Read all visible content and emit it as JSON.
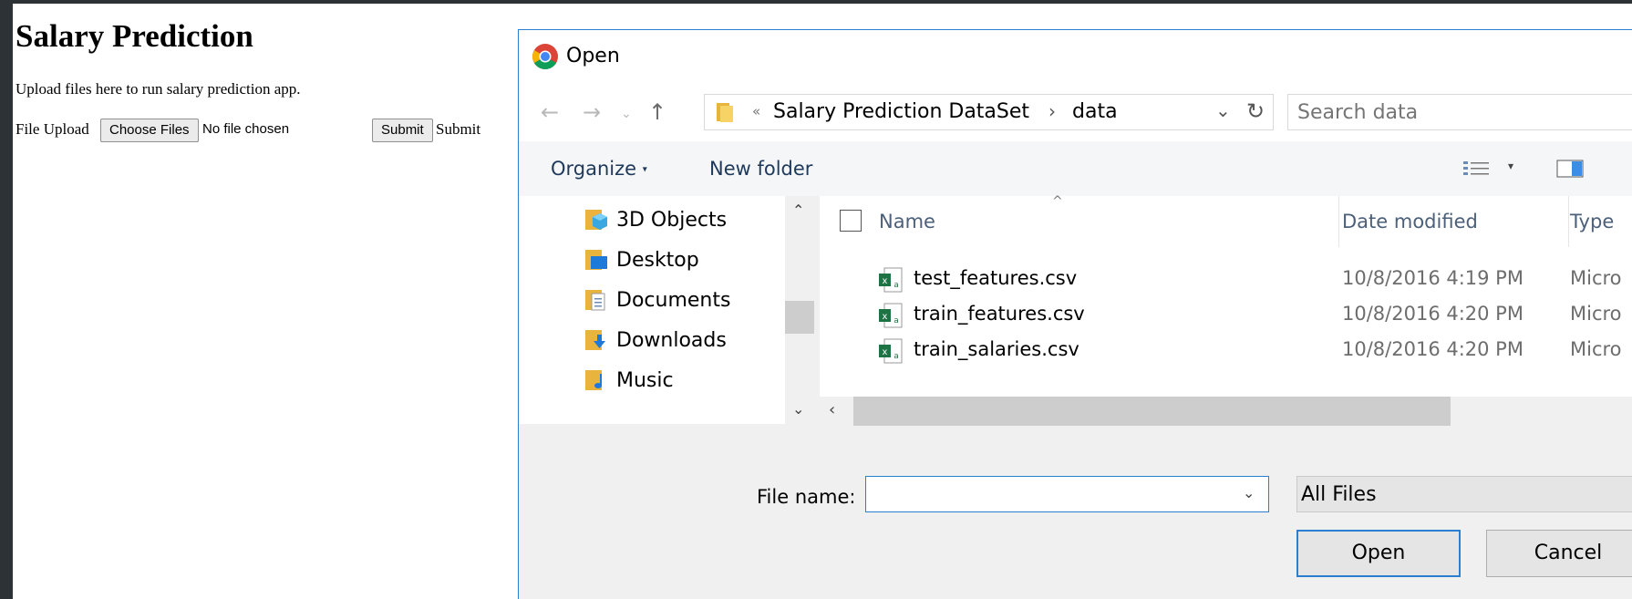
{
  "page": {
    "title": "Salary Prediction",
    "description": "Upload files here to run salary prediction app.",
    "upload_label": "File Upload",
    "choose_files_label": "Choose Files",
    "no_file_text": "No file chosen",
    "submit_button_label": "Submit",
    "submit_text": "Submit"
  },
  "dialog": {
    "title": "Open",
    "breadcrumb": [
      "Salary Prediction DataSet",
      "data"
    ],
    "search_placeholder": "Search data",
    "toolbar": {
      "organize": "Organize",
      "new_folder": "New folder"
    },
    "nav_items": [
      {
        "label": "3D Objects",
        "icon": "3d-objects-icon"
      },
      {
        "label": "Desktop",
        "icon": "desktop-icon"
      },
      {
        "label": "Documents",
        "icon": "documents-icon"
      },
      {
        "label": "Downloads",
        "icon": "downloads-icon"
      },
      {
        "label": "Music",
        "icon": "music-icon"
      }
    ],
    "columns": {
      "name": "Name",
      "date": "Date modified",
      "type": "Type"
    },
    "files": [
      {
        "name": "test_features.csv",
        "date": "10/8/2016 4:19 PM",
        "type": "Micro"
      },
      {
        "name": "train_features.csv",
        "date": "10/8/2016 4:20 PM",
        "type": "Micro"
      },
      {
        "name": "train_salaries.csv",
        "date": "10/8/2016 4:20 PM",
        "type": "Micro"
      }
    ],
    "file_name_label": "File name:",
    "file_name_value": "",
    "file_type_filter": "All Files",
    "open_label": "Open",
    "cancel_label": "Cancel"
  },
  "colors": {
    "accent": "#2b7fd0",
    "background": "#2d3236",
    "excel_green": "#1d7344"
  }
}
